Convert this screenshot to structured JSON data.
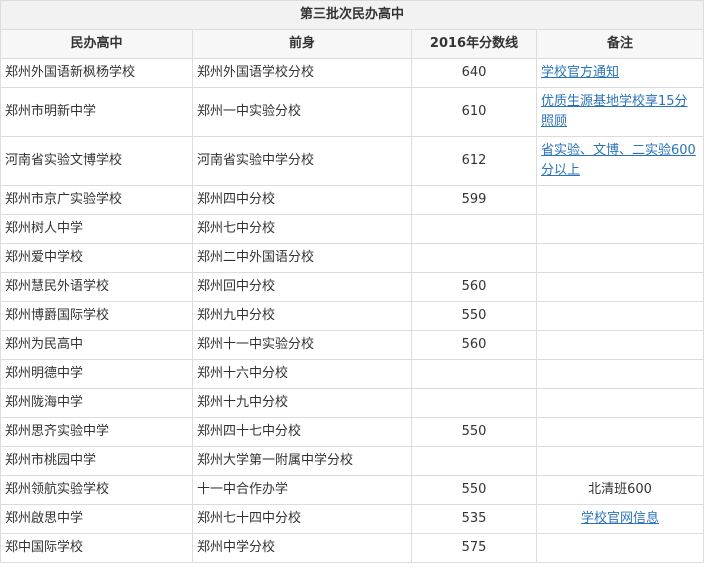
{
  "table": {
    "title": "第三批次民办高中",
    "headers": [
      "民办高中",
      "前身",
      "2016年分数线",
      "备注"
    ],
    "rows": [
      {
        "school": "郑州外国语新枫杨学校",
        "former": "郑州外国语学校分校",
        "score": "640",
        "note": "学校官方通知",
        "note_is_link": true
      },
      {
        "school": "郑州市明新中学",
        "former": "郑州一中实验分校",
        "score": "610",
        "note": "优质生源基地学校享15分照顾",
        "note_is_link": true
      },
      {
        "school": "河南省实验文博学校",
        "former": "河南省实验中学分校",
        "score": "612",
        "note": "省实验、文博、二实验600分以上",
        "note_is_link": true
      },
      {
        "school": "郑州市京广实验学校",
        "former": "郑州四中分校",
        "score": "599",
        "note": "",
        "note_is_link": false
      },
      {
        "school": "郑州树人中学",
        "former": "郑州七中分校",
        "score": "",
        "note": "",
        "note_is_link": false
      },
      {
        "school": "郑州爱中学校",
        "former": "郑州二中外国语分校",
        "score": "",
        "note": "",
        "note_is_link": false
      },
      {
        "school": "郑州慧民外语学校",
        "former": "郑州回中分校",
        "score": "560",
        "note": "",
        "note_is_link": false
      },
      {
        "school": "郑州博爵国际学校",
        "former": "郑州九中分校",
        "score": "550",
        "note": "",
        "note_is_link": false
      },
      {
        "school": "郑州为民高中",
        "former": "郑州十一中实验分校",
        "score": "560",
        "note": "",
        "note_is_link": false
      },
      {
        "school": "郑州明德中学",
        "former": "郑州十六中分校",
        "score": "",
        "note": "",
        "note_is_link": false
      },
      {
        "school": "郑州陇海中学",
        "former": "郑州十九中分校",
        "score": "",
        "note": "",
        "note_is_link": false
      },
      {
        "school": "郑州思齐实验中学",
        "former": "郑州四十七中分校",
        "score": "550",
        "note": "",
        "note_is_link": false
      },
      {
        "school": "郑州市桃园中学",
        "former": "郑州大学第一附属中学分校",
        "score": "",
        "note": "",
        "note_is_link": false
      },
      {
        "school": "郑州领航实验学校",
        "former": "十一中合作办学",
        "score": "550",
        "note": "北清班600",
        "note_is_link": false
      },
      {
        "school": "郑州啟思中学",
        "former": "郑州七十四中分校",
        "score": "535",
        "note": "学校官网信息",
        "note_is_link": true
      },
      {
        "school": "郑中国际学校",
        "former": "郑州中学分校",
        "score": "575",
        "note": "",
        "note_is_link": false
      }
    ]
  },
  "colors": {
    "link": "#2a73b8",
    "border": "#dcdcdc",
    "title_bg": "#f2f2f2",
    "header_bg": "#f7f7f7",
    "text": "#333333"
  }
}
